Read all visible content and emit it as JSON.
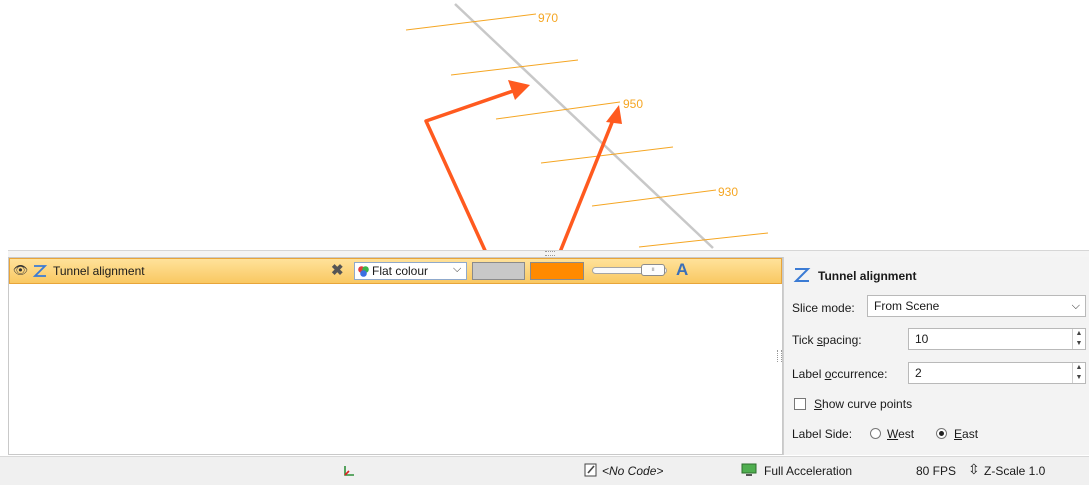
{
  "scene": {
    "tick_labels": [
      "970",
      "950",
      "930"
    ],
    "tick_color": "#f5a623",
    "alignment_color": "#c8c8c8",
    "arrow_color": "#ff5a1f"
  },
  "shape_row": {
    "name": "Tunnel alignment",
    "colour_mode": "Flat colour",
    "line_colour": "#c8c8c8",
    "label_colour": "#ff8a00"
  },
  "props": {
    "title": "Tunnel alignment",
    "slice_mode_label_pre": "Slice mode:",
    "slice_mode_value": "From Scene",
    "tick_spacing_label_pre": "Tick ",
    "tick_spacing_label_ul": "s",
    "tick_spacing_label_post": "pacing:",
    "tick_spacing_value": "10",
    "label_occurrence_label_pre": "Label ",
    "label_occurrence_label_ul": "o",
    "label_occurrence_label_post": "ccurrence:",
    "label_occurrence_value": "2",
    "show_points_ul": "S",
    "show_points_post": "how curve points",
    "label_side_label": "Label Side:",
    "west_ul": "W",
    "west_post": "est",
    "east_ul": "E",
    "east_post": "ast",
    "label_side_selected": "East"
  },
  "status": {
    "code": "<No Code>",
    "acceleration": "Full Acceleration",
    "fps": "80 FPS",
    "zscale": "Z-Scale 1.0"
  }
}
